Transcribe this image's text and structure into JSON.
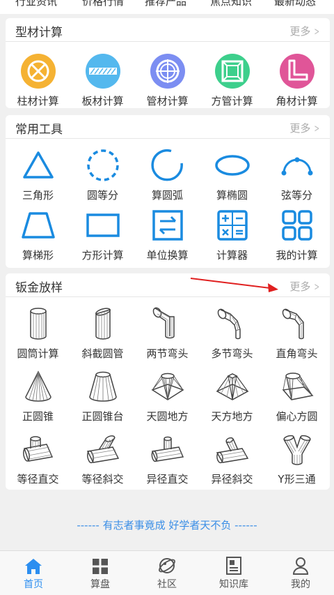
{
  "colors": {
    "accent": "#2c8ef0",
    "icon_blue": "#1a8be0",
    "slogan": "#3a8ee6",
    "arrow": "#e02020"
  },
  "top_tabs": [
    "行业资讯",
    "价格行情",
    "推荐产品",
    "焦点知识",
    "最新动态"
  ],
  "profile_calc": {
    "title": "型材计算",
    "more": "更多",
    "items": [
      {
        "label": "柱材计算",
        "icon": "round-bar-icon",
        "color": "#f5b233"
      },
      {
        "label": "板材计算",
        "icon": "plate-icon",
        "color": "#54b8ee"
      },
      {
        "label": "管材计算",
        "icon": "pipe-icon",
        "color": "#7c8ef2"
      },
      {
        "label": "方管计算",
        "icon": "square-tube-icon",
        "color": "#3dcf8c"
      },
      {
        "label": "角材计算",
        "icon": "angle-steel-icon",
        "color": "#e05598"
      }
    ]
  },
  "common_tools": {
    "title": "常用工具",
    "more": "更多",
    "items": [
      {
        "label": "三角形",
        "icon": "triangle-icon"
      },
      {
        "label": "圆等分",
        "icon": "circle-divide-icon"
      },
      {
        "label": "算圆弧",
        "icon": "arc-icon"
      },
      {
        "label": "算椭圆",
        "icon": "ellipse-icon"
      },
      {
        "label": "弦等分",
        "icon": "chord-divide-icon"
      },
      {
        "label": "算梯形",
        "icon": "trapezoid-icon"
      },
      {
        "label": "方形计算",
        "icon": "rectangle-icon"
      },
      {
        "label": "单位换算",
        "icon": "unit-convert-icon"
      },
      {
        "label": "计算器",
        "icon": "calculator-icon"
      },
      {
        "label": "我的计算",
        "icon": "my-calc-icon"
      }
    ]
  },
  "sheet_metal": {
    "title": "钣金放样",
    "more": "更多",
    "items": [
      {
        "label": "圆筒计算",
        "icon": "cylinder-icon"
      },
      {
        "label": "斜截圆管",
        "icon": "oblique-pipe-icon"
      },
      {
        "label": "两节弯头",
        "icon": "two-segment-elbow-icon"
      },
      {
        "label": "多节弯头",
        "icon": "multi-segment-elbow-icon"
      },
      {
        "label": "直角弯头",
        "icon": "right-angle-elbow-icon"
      },
      {
        "label": "正圆锥",
        "icon": "cone-icon"
      },
      {
        "label": "正圆锥台",
        "icon": "frustum-icon"
      },
      {
        "label": "天圆地方",
        "icon": "round-to-square-icon"
      },
      {
        "label": "天方地方",
        "icon": "square-to-square-icon"
      },
      {
        "label": "偏心方圆",
        "icon": "eccentric-transition-icon"
      },
      {
        "label": "等径直交",
        "icon": "equal-tee-icon"
      },
      {
        "label": "等径斜交",
        "icon": "equal-lateral-icon"
      },
      {
        "label": "异径直交",
        "icon": "reducing-tee-icon"
      },
      {
        "label": "异径斜交",
        "icon": "reducing-lateral-icon"
      },
      {
        "label": "Y形三通",
        "icon": "y-branch-icon"
      }
    ]
  },
  "slogan": "------ 有志者事竟成 好学者天不负 ------",
  "tabbar": [
    {
      "label": "首页",
      "icon": "home-icon",
      "active": true
    },
    {
      "label": "算盘",
      "icon": "grid-icon",
      "active": false
    },
    {
      "label": "社区",
      "icon": "planet-icon",
      "active": false
    },
    {
      "label": "知识库",
      "icon": "book-icon",
      "active": false
    },
    {
      "label": "我的",
      "icon": "user-icon",
      "active": false
    }
  ]
}
